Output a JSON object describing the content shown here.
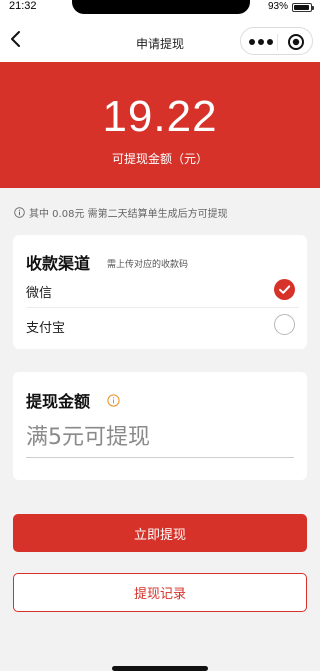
{
  "status_bar": {
    "time": "21:32",
    "battery_percent": "93%",
    "battery_level": 0.93
  },
  "nav": {
    "title": "申请提现",
    "icons": [
      "chevron-left-icon",
      "more-icon",
      "close-icon"
    ]
  },
  "hero": {
    "amount": "19.22",
    "label": "可提现金额（元）",
    "background_color": "#d6322a"
  },
  "notice": {
    "text": "其中 0.08元 需第二天结算单生成后方可提现",
    "icon": "info-icon"
  },
  "channel": {
    "title": "收款渠道",
    "hint": "需上传对应的收款码",
    "options": [
      {
        "label": "微信",
        "selected": true
      },
      {
        "label": "支付宝",
        "selected": false
      }
    ]
  },
  "amount": {
    "title": "提现金额",
    "icon": "info-icon",
    "value": "",
    "placeholder": "满5元可提现"
  },
  "buttons": {
    "primary": "立即提现",
    "secondary": "提现记录"
  },
  "colors": {
    "accent": "#d6322a",
    "page_background": "#f2f2f2"
  }
}
